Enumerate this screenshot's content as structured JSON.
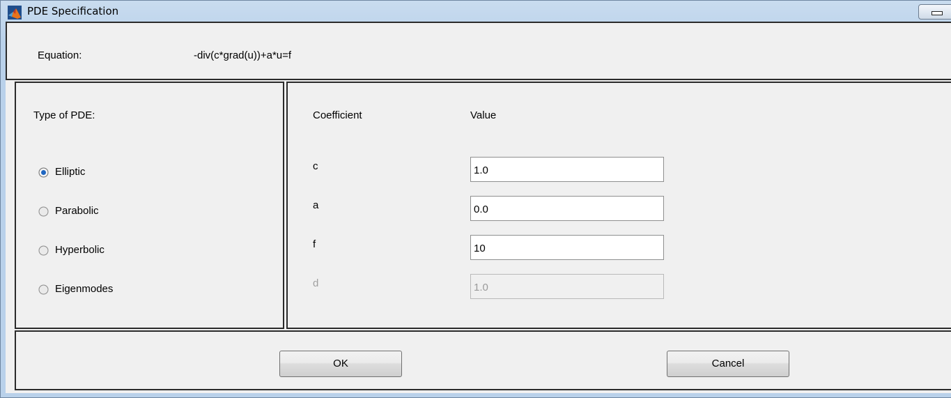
{
  "window": {
    "title": "PDE Specification",
    "icon": "matlab-logo-icon",
    "minimize_icon": "minimize-icon"
  },
  "equation": {
    "label": "Equation:",
    "value": "-div(c*grad(u))+a*u=f"
  },
  "pde_type": {
    "heading": "Type of PDE:",
    "options": [
      {
        "label": "Elliptic",
        "selected": true
      },
      {
        "label": "Parabolic",
        "selected": false
      },
      {
        "label": "Hyperbolic",
        "selected": false
      },
      {
        "label": "Eigenmodes",
        "selected": false
      }
    ]
  },
  "coefficients": {
    "header_coefficient": "Coefficient",
    "header_value": "Value",
    "rows": [
      {
        "name": "c",
        "value": "1.0",
        "enabled": true
      },
      {
        "name": "a",
        "value": "0.0",
        "enabled": true
      },
      {
        "name": "f",
        "value": "10",
        "enabled": true
      },
      {
        "name": "d",
        "value": "1.0",
        "enabled": false
      }
    ]
  },
  "buttons": {
    "ok_label": "OK",
    "cancel_label": "Cancel"
  }
}
